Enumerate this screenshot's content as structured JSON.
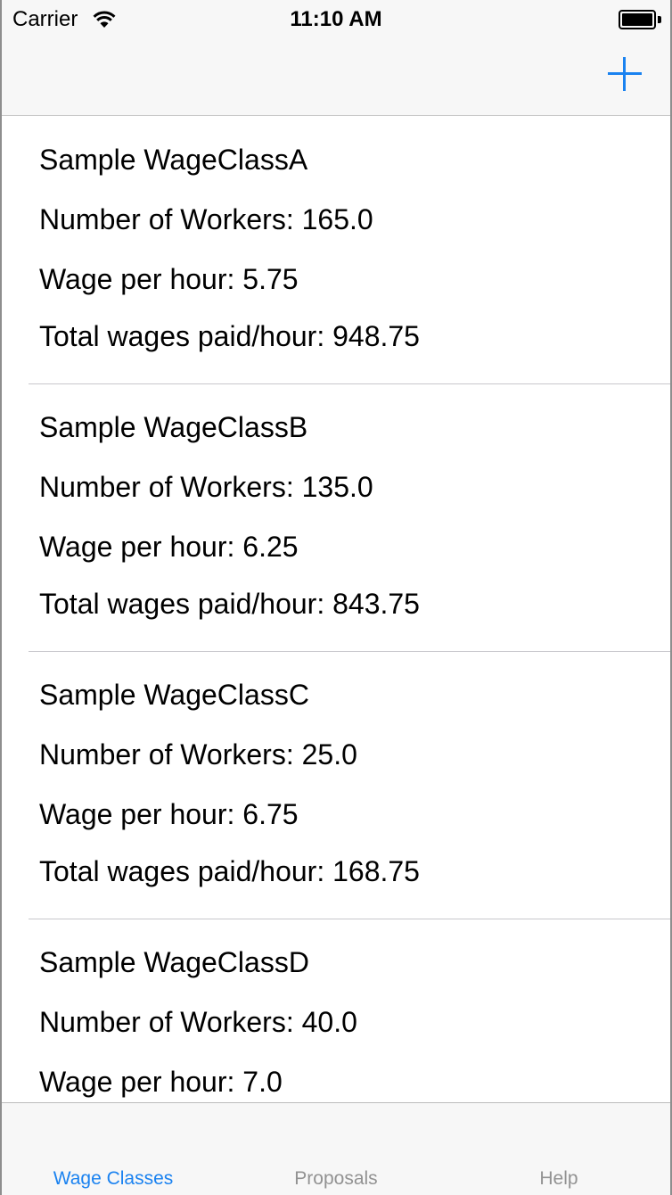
{
  "status_bar": {
    "carrier": "Carrier",
    "time": "11:10 AM"
  },
  "nav": {
    "add_icon": "plus-icon",
    "accent_color": "#1a82f0"
  },
  "wage_classes": [
    {
      "name": "Sample WageClassA",
      "workers": "Number of Workers: 165.0",
      "wage": "Wage per hour: 5.75",
      "total": "Total wages paid/hour: 948.75"
    },
    {
      "name": "Sample WageClassB",
      "workers": "Number of Workers: 135.0",
      "wage": "Wage per hour: 6.25",
      "total": "Total wages paid/hour: 843.75"
    },
    {
      "name": "Sample WageClassC",
      "workers": "Number of Workers: 25.0",
      "wage": "Wage per hour: 6.75",
      "total": "Total wages paid/hour: 168.75"
    },
    {
      "name": "Sample WageClassD",
      "workers": "Number of Workers: 40.0",
      "wage": "Wage per hour: 7.0",
      "total": ""
    }
  ],
  "tabs": [
    {
      "label": "Wage Classes",
      "active": true
    },
    {
      "label": "Proposals",
      "active": false
    },
    {
      "label": "Help",
      "active": false
    }
  ]
}
